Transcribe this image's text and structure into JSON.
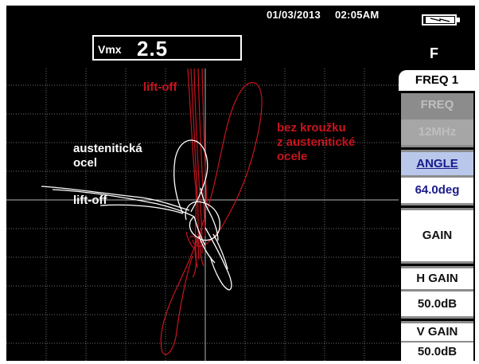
{
  "status": {
    "date": "01/03/2013",
    "time": "02:05AM",
    "mode_letter": "F"
  },
  "readout": {
    "label": "Vmx",
    "value": "2.5"
  },
  "annotations": {
    "liftoff_red": "lift-off",
    "ring_line1": "bez kroužku",
    "ring_line2": "z austenitické",
    "ring_line3": "ocele",
    "steel_line1": "austenitická",
    "steel_line2": "ocel",
    "liftoff_white": "lift-off"
  },
  "menu": {
    "title": "FREQ 1",
    "items": [
      {
        "label": "FREQ",
        "value": "12MHz",
        "state": "disabled"
      },
      {
        "label": "ANGLE",
        "value": "64.0deg",
        "state": "active"
      },
      {
        "label": "GAIN",
        "value": "",
        "state": "plain"
      },
      {
        "label": "H GAIN",
        "value": "50.0dB",
        "state": "plain"
      },
      {
        "label": "V GAIN",
        "value": "50.0dB",
        "state": "plain"
      }
    ]
  },
  "colors": {
    "background": "#000000",
    "grid": "#6e6e6e",
    "signal_red": "#c8141e",
    "signal_white": "#ffffff",
    "active_highlight": "#b9c8ea"
  }
}
